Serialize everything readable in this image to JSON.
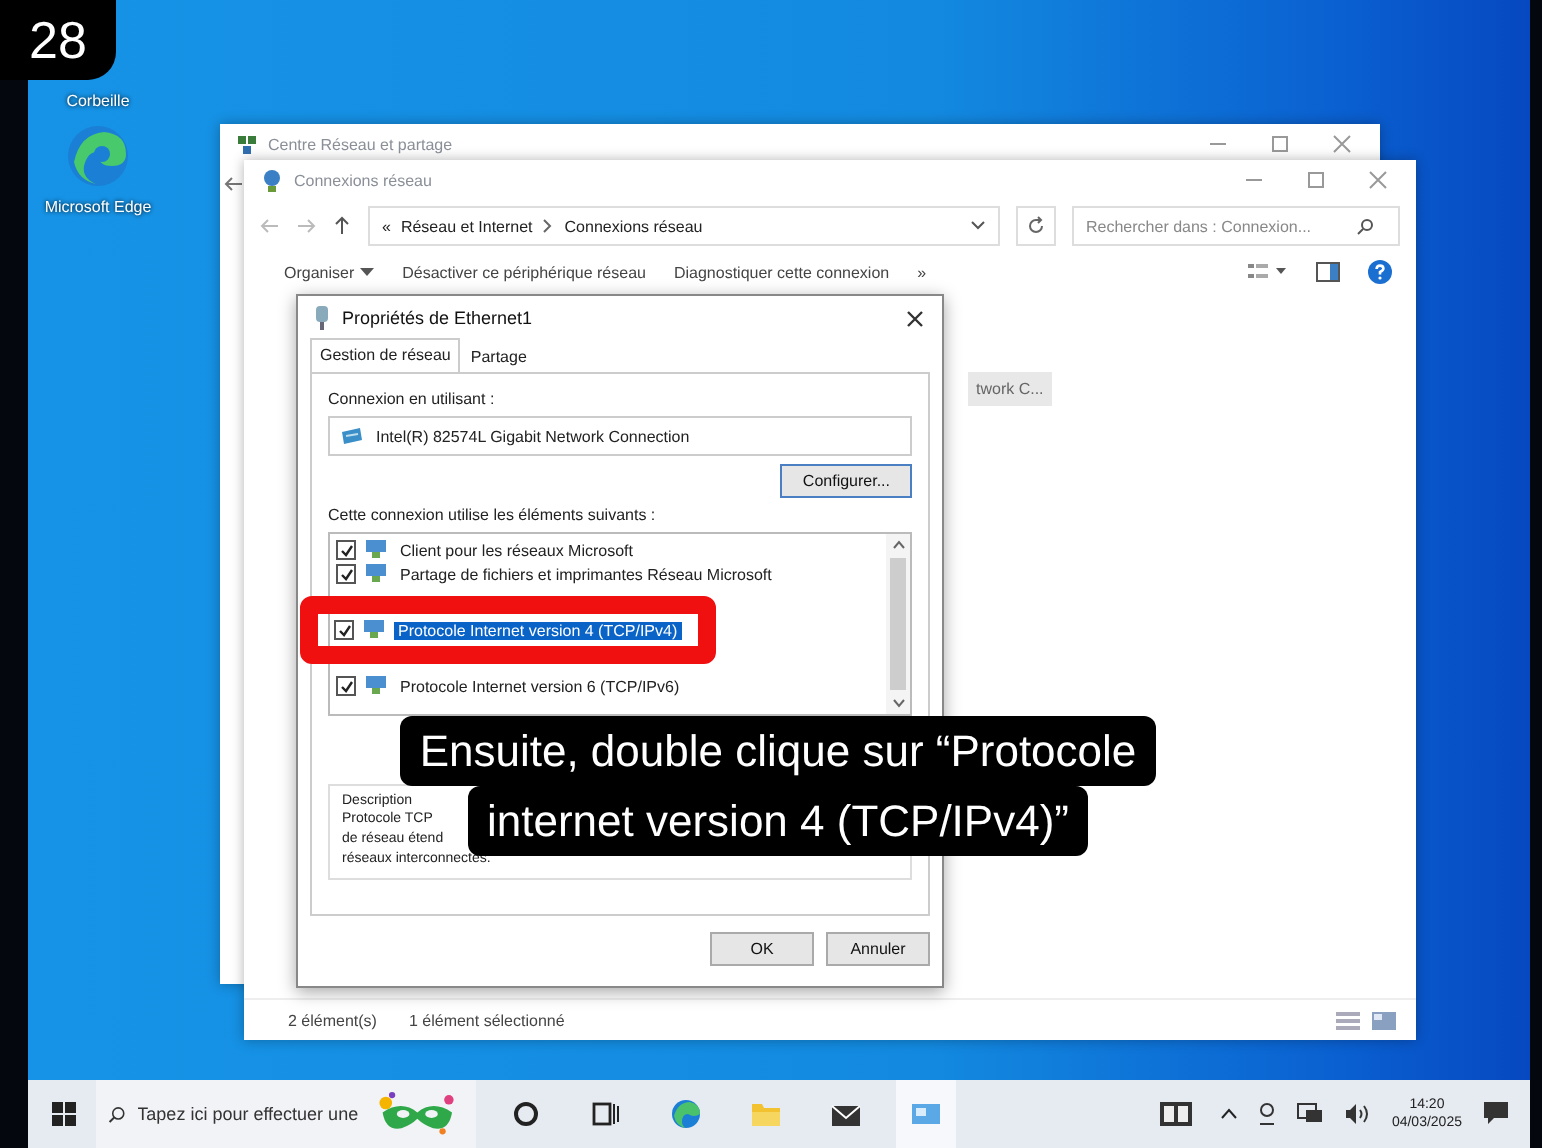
{
  "step_badge": "28",
  "desktop_icons": [
    {
      "kind": "bin",
      "label": "Corbeille"
    },
    {
      "kind": "edge",
      "label": "Microsoft Edge"
    }
  ],
  "back_window": {
    "title": "Centre Réseau et partage"
  },
  "explorer": {
    "title": "Connexions réseau",
    "breadcrumb_prefix": "«",
    "breadcrumb": [
      "Réseau et Internet",
      "Connexions réseau"
    ],
    "search": {
      "placeholder": "Rechercher dans : Connexion..."
    },
    "toolbar": [
      {
        "label": "Organiser",
        "menu": true
      },
      {
        "label": "Désactiver ce périphérique réseau",
        "menu": false
      },
      {
        "label": "Diagnostiquer cette connexion",
        "menu": false
      }
    ],
    "toolbar_overflow": "»",
    "item_fragment": "twork C...",
    "status": [
      "2 élément(s)",
      "1 élément sélectionné"
    ]
  },
  "dialog": {
    "title": "Propriétés de Ethernet1",
    "tabs": [
      {
        "label": "Gestion de réseau",
        "selected": true
      },
      {
        "label": "Partage",
        "selected": false
      }
    ],
    "connect_label": "Connexion en utilisant :",
    "adapter": "Intel(R) 82574L Gigabit Network Connection",
    "configure_button": "Configurer...",
    "items_label": "Cette connexion utilise les éléments suivants :",
    "items": [
      {
        "label": "Client pour les réseaux Microsoft",
        "checked": true,
        "selected": false,
        "highlighted": false
      },
      {
        "label": "Partage de fichiers et imprimantes Réseau Microsoft",
        "checked": true,
        "selected": false,
        "highlighted": false
      },
      {
        "label": "Protocole Internet version 4 (TCP/IPv4)",
        "checked": true,
        "selected": true,
        "highlighted": true
      },
      {
        "label": "Protocole Internet version 6 (TCP/IPv6)",
        "checked": true,
        "selected": false,
        "highlighted": false
      }
    ],
    "description_label": "Description",
    "description_lines": [
      "Protocole TCP",
      "de réseau étend",
      "réseaux interconnectés."
    ],
    "buttons": [
      "OK",
      "Annuler"
    ]
  },
  "caption": {
    "lines": [
      "Ensuite, double clique sur “Protocole",
      "internet version 4 (TCP/IPv4)”"
    ]
  },
  "taskbar": {
    "search_placeholder": "Tapez ici pour effectuer une",
    "apps": [
      {
        "kind": "cortana",
        "active": false
      },
      {
        "kind": "taskview",
        "active": false
      },
      {
        "kind": "edge",
        "active": false
      },
      {
        "kind": "folder",
        "active": false
      },
      {
        "kind": "mail",
        "active": false
      },
      {
        "kind": "network",
        "active": true
      }
    ],
    "clock": {
      "time": "14:20",
      "date": "04/03/2025"
    }
  }
}
